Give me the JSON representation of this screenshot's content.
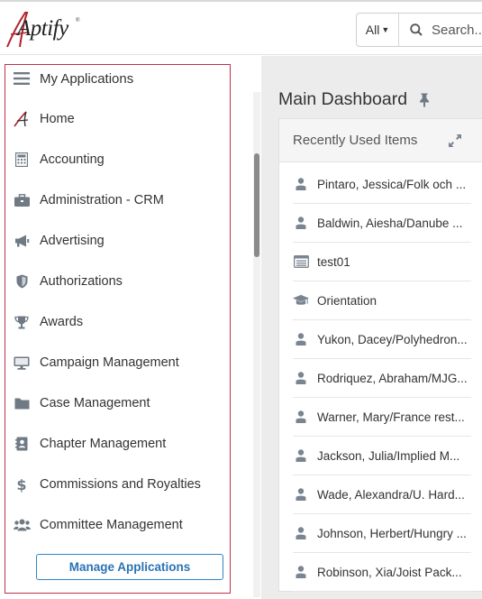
{
  "header": {
    "logo_text": "Aptify",
    "logo_reg": "®",
    "search_scope": "All",
    "search_placeholder": "Search..."
  },
  "sidebar": {
    "title": "My Applications",
    "items": [
      {
        "label": "Home",
        "icon": "aptify-logo-icon"
      },
      {
        "label": "Accounting",
        "icon": "calculator-icon"
      },
      {
        "label": "Administration - CRM",
        "icon": "briefcase-icon"
      },
      {
        "label": "Advertising",
        "icon": "megaphone-icon"
      },
      {
        "label": "Authorizations",
        "icon": "shield-icon"
      },
      {
        "label": "Awards",
        "icon": "trophy-icon"
      },
      {
        "label": "Campaign Management",
        "icon": "monitor-icon"
      },
      {
        "label": "Case Management",
        "icon": "folder-icon"
      },
      {
        "label": "Chapter Management",
        "icon": "contact-book-icon"
      },
      {
        "label": "Commissions and Royalties",
        "icon": "dollar-icon"
      },
      {
        "label": "Committee Management",
        "icon": "users-icon"
      }
    ],
    "manage_button": "Manage Applications"
  },
  "main": {
    "title": "Main Dashboard",
    "recent": {
      "title": "Recently Used Items",
      "items": [
        {
          "label": "Pintaro, Jessica/Folk och ...",
          "icon": "person-icon"
        },
        {
          "label": "Baldwin, Aiesha/Danube ...",
          "icon": "person-icon"
        },
        {
          "label": "test01",
          "icon": "list-card-icon"
        },
        {
          "label": "Orientation",
          "icon": "graduation-cap-icon"
        },
        {
          "label": "Yukon, Dacey/Polyhedron...",
          "icon": "person-icon"
        },
        {
          "label": "Rodriquez, Abraham/MJG...",
          "icon": "person-icon"
        },
        {
          "label": "Warner, Mary/France rest...",
          "icon": "person-icon"
        },
        {
          "label": "Jackson, Julia/Implied M...",
          "icon": "person-icon"
        },
        {
          "label": "Wade, Alexandra/U. Hard...",
          "icon": "person-icon"
        },
        {
          "label": "Johnson, Herbert/Hungry ...",
          "icon": "person-icon"
        },
        {
          "label": "Robinson, Xia/Joist Pack...",
          "icon": "person-icon"
        }
      ]
    }
  },
  "colors": {
    "accent_blue": "#2a73b5",
    "sidebar_border": "#c0304a",
    "icon_grey": "#6f7a85"
  }
}
